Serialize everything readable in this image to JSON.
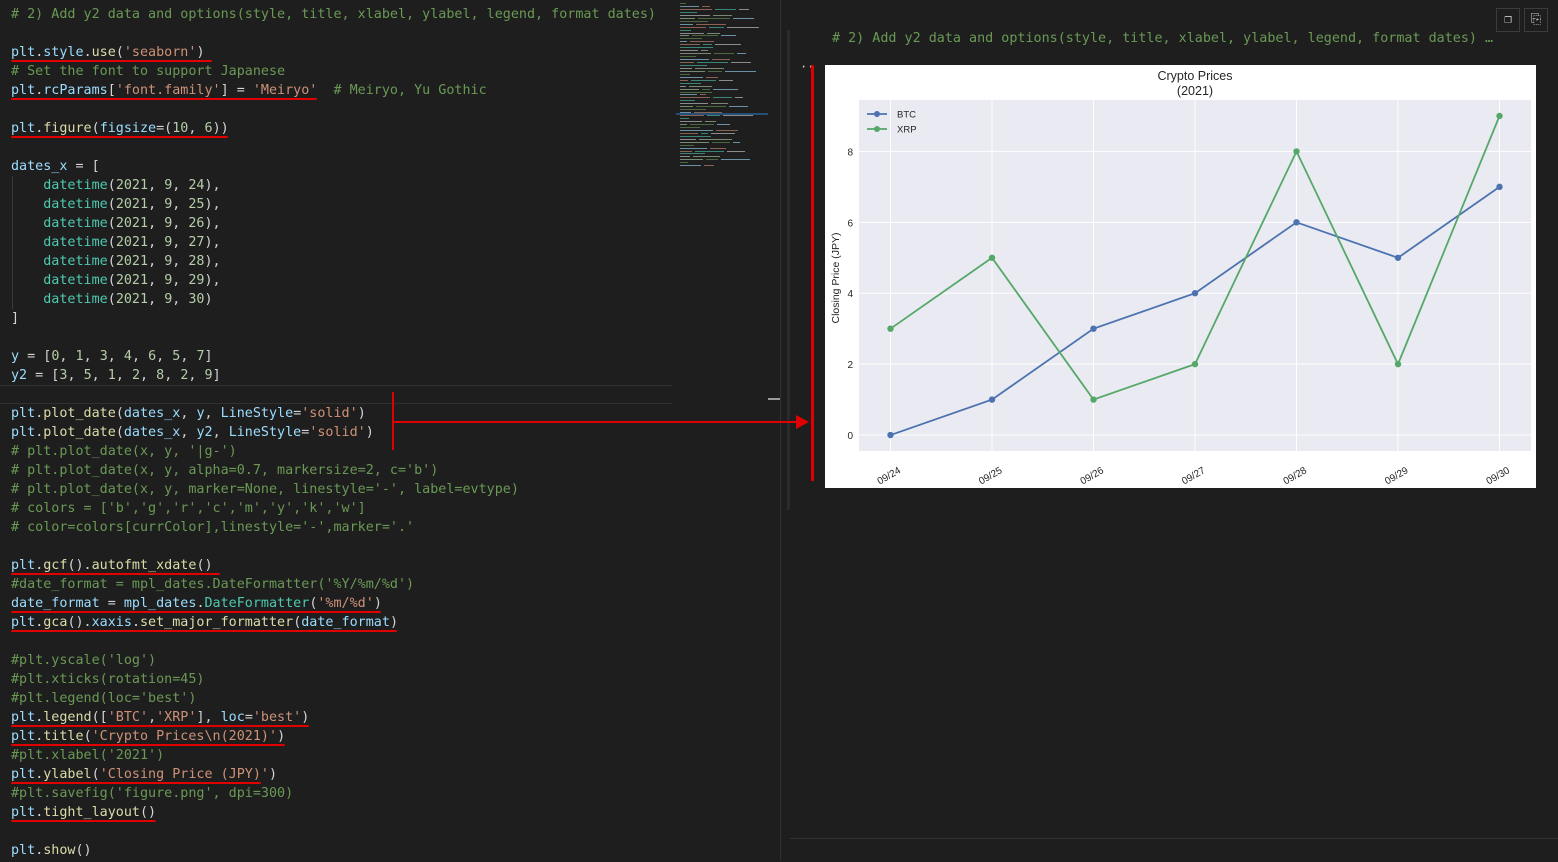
{
  "code": [
    {
      "y": 5,
      "tokens": [
        {
          "t": "# 2) Add y2 data and options(style, title, xlabel, ylabel, legend, format dates)",
          "c": "com"
        }
      ]
    },
    {
      "y": 43,
      "tokens": [
        {
          "t": "plt",
          "c": "var"
        },
        {
          "t": ".",
          "c": "plain"
        },
        {
          "t": "style",
          "c": "var"
        },
        {
          "t": ".",
          "c": "plain"
        },
        {
          "t": "use",
          "c": "fn"
        },
        {
          "t": "(",
          "c": "plain"
        },
        {
          "t": "'seaborn'",
          "c": "str"
        },
        {
          "t": ")",
          "c": "plain"
        }
      ]
    },
    {
      "y": 62,
      "tokens": [
        {
          "t": "# Set the font to support Japanese",
          "c": "com"
        }
      ]
    },
    {
      "y": 81,
      "tokens": [
        {
          "t": "plt",
          "c": "var"
        },
        {
          "t": ".",
          "c": "plain"
        },
        {
          "t": "rcParams",
          "c": "var"
        },
        {
          "t": "[",
          "c": "plain"
        },
        {
          "t": "'font.family'",
          "c": "str"
        },
        {
          "t": "] = ",
          "c": "plain"
        },
        {
          "t": "'Meiryo'",
          "c": "str"
        },
        {
          "t": "  ",
          "c": "plain"
        },
        {
          "t": "# Meiryo, Yu Gothic",
          "c": "com"
        }
      ]
    },
    {
      "y": 119,
      "tokens": [
        {
          "t": "plt",
          "c": "var"
        },
        {
          "t": ".",
          "c": "plain"
        },
        {
          "t": "figure",
          "c": "fn"
        },
        {
          "t": "(",
          "c": "plain"
        },
        {
          "t": "figsize",
          "c": "var"
        },
        {
          "t": "=(",
          "c": "plain"
        },
        {
          "t": "10",
          "c": "num"
        },
        {
          "t": ", ",
          "c": "plain"
        },
        {
          "t": "6",
          "c": "num"
        },
        {
          "t": "))",
          "c": "plain"
        }
      ]
    },
    {
      "y": 157,
      "tokens": [
        {
          "t": "dates_x",
          "c": "var"
        },
        {
          "t": " = [",
          "c": "plain"
        }
      ]
    },
    {
      "y": 176,
      "tokens": [
        {
          "t": "    ",
          "c": "plain"
        },
        {
          "t": "datetime",
          "c": "cls"
        },
        {
          "t": "(",
          "c": "plain"
        },
        {
          "t": "2021",
          "c": "num"
        },
        {
          "t": ", ",
          "c": "plain"
        },
        {
          "t": "9",
          "c": "num"
        },
        {
          "t": ", ",
          "c": "plain"
        },
        {
          "t": "24",
          "c": "num"
        },
        {
          "t": "),",
          "c": "plain"
        }
      ]
    },
    {
      "y": 195,
      "tokens": [
        {
          "t": "    ",
          "c": "plain"
        },
        {
          "t": "datetime",
          "c": "cls"
        },
        {
          "t": "(",
          "c": "plain"
        },
        {
          "t": "2021",
          "c": "num"
        },
        {
          "t": ", ",
          "c": "plain"
        },
        {
          "t": "9",
          "c": "num"
        },
        {
          "t": ", ",
          "c": "plain"
        },
        {
          "t": "25",
          "c": "num"
        },
        {
          "t": "),",
          "c": "plain"
        }
      ]
    },
    {
      "y": 214,
      "tokens": [
        {
          "t": "    ",
          "c": "plain"
        },
        {
          "t": "datetime",
          "c": "cls"
        },
        {
          "t": "(",
          "c": "plain"
        },
        {
          "t": "2021",
          "c": "num"
        },
        {
          "t": ", ",
          "c": "plain"
        },
        {
          "t": "9",
          "c": "num"
        },
        {
          "t": ", ",
          "c": "plain"
        },
        {
          "t": "26",
          "c": "num"
        },
        {
          "t": "),",
          "c": "plain"
        }
      ]
    },
    {
      "y": 233,
      "tokens": [
        {
          "t": "    ",
          "c": "plain"
        },
        {
          "t": "datetime",
          "c": "cls"
        },
        {
          "t": "(",
          "c": "plain"
        },
        {
          "t": "2021",
          "c": "num"
        },
        {
          "t": ", ",
          "c": "plain"
        },
        {
          "t": "9",
          "c": "num"
        },
        {
          "t": ", ",
          "c": "plain"
        },
        {
          "t": "27",
          "c": "num"
        },
        {
          "t": "),",
          "c": "plain"
        }
      ]
    },
    {
      "y": 252,
      "tokens": [
        {
          "t": "    ",
          "c": "plain"
        },
        {
          "t": "datetime",
          "c": "cls"
        },
        {
          "t": "(",
          "c": "plain"
        },
        {
          "t": "2021",
          "c": "num"
        },
        {
          "t": ", ",
          "c": "plain"
        },
        {
          "t": "9",
          "c": "num"
        },
        {
          "t": ", ",
          "c": "plain"
        },
        {
          "t": "28",
          "c": "num"
        },
        {
          "t": "),",
          "c": "plain"
        }
      ]
    },
    {
      "y": 271,
      "tokens": [
        {
          "t": "    ",
          "c": "plain"
        },
        {
          "t": "datetime",
          "c": "cls"
        },
        {
          "t": "(",
          "c": "plain"
        },
        {
          "t": "2021",
          "c": "num"
        },
        {
          "t": ", ",
          "c": "plain"
        },
        {
          "t": "9",
          "c": "num"
        },
        {
          "t": ", ",
          "c": "plain"
        },
        {
          "t": "29",
          "c": "num"
        },
        {
          "t": "),",
          "c": "plain"
        }
      ]
    },
    {
      "y": 290,
      "tokens": [
        {
          "t": "    ",
          "c": "plain"
        },
        {
          "t": "datetime",
          "c": "cls"
        },
        {
          "t": "(",
          "c": "plain"
        },
        {
          "t": "2021",
          "c": "num"
        },
        {
          "t": ", ",
          "c": "plain"
        },
        {
          "t": "9",
          "c": "num"
        },
        {
          "t": ", ",
          "c": "plain"
        },
        {
          "t": "30",
          "c": "num"
        },
        {
          "t": ")",
          "c": "plain"
        }
      ]
    },
    {
      "y": 309,
      "tokens": [
        {
          "t": "]",
          "c": "plain"
        }
      ]
    },
    {
      "y": 347,
      "tokens": [
        {
          "t": "y",
          "c": "var"
        },
        {
          "t": " = [",
          "c": "plain"
        },
        {
          "t": "0",
          "c": "num"
        },
        {
          "t": ", ",
          "c": "plain"
        },
        {
          "t": "1",
          "c": "num"
        },
        {
          "t": ", ",
          "c": "plain"
        },
        {
          "t": "3",
          "c": "num"
        },
        {
          "t": ", ",
          "c": "plain"
        },
        {
          "t": "4",
          "c": "num"
        },
        {
          "t": ", ",
          "c": "plain"
        },
        {
          "t": "6",
          "c": "num"
        },
        {
          "t": ", ",
          "c": "plain"
        },
        {
          "t": "5",
          "c": "num"
        },
        {
          "t": ", ",
          "c": "plain"
        },
        {
          "t": "7",
          "c": "num"
        },
        {
          "t": "]",
          "c": "plain"
        }
      ]
    },
    {
      "y": 366,
      "tokens": [
        {
          "t": "y2",
          "c": "var"
        },
        {
          "t": " = [",
          "c": "plain"
        },
        {
          "t": "3",
          "c": "num"
        },
        {
          "t": ", ",
          "c": "plain"
        },
        {
          "t": "5",
          "c": "num"
        },
        {
          "t": ", ",
          "c": "plain"
        },
        {
          "t": "1",
          "c": "num"
        },
        {
          "t": ", ",
          "c": "plain"
        },
        {
          "t": "2",
          "c": "num"
        },
        {
          "t": ", ",
          "c": "plain"
        },
        {
          "t": "8",
          "c": "num"
        },
        {
          "t": ", ",
          "c": "plain"
        },
        {
          "t": "2",
          "c": "num"
        },
        {
          "t": ", ",
          "c": "plain"
        },
        {
          "t": "9",
          "c": "num"
        },
        {
          "t": "]",
          "c": "plain"
        }
      ]
    },
    {
      "y": 404,
      "tokens": [
        {
          "t": "plt",
          "c": "var"
        },
        {
          "t": ".",
          "c": "plain"
        },
        {
          "t": "plot_date",
          "c": "fn"
        },
        {
          "t": "(",
          "c": "plain"
        },
        {
          "t": "dates_x",
          "c": "var"
        },
        {
          "t": ", ",
          "c": "plain"
        },
        {
          "t": "y",
          "c": "var"
        },
        {
          "t": ", ",
          "c": "plain"
        },
        {
          "t": "LineStyle",
          "c": "var"
        },
        {
          "t": "=",
          "c": "plain"
        },
        {
          "t": "'solid'",
          "c": "str"
        },
        {
          "t": ")",
          "c": "plain"
        }
      ]
    },
    {
      "y": 423,
      "tokens": [
        {
          "t": "plt",
          "c": "var"
        },
        {
          "t": ".",
          "c": "plain"
        },
        {
          "t": "plot_date",
          "c": "fn"
        },
        {
          "t": "(",
          "c": "plain"
        },
        {
          "t": "dates_x",
          "c": "var"
        },
        {
          "t": ", ",
          "c": "plain"
        },
        {
          "t": "y2",
          "c": "var"
        },
        {
          "t": ", ",
          "c": "plain"
        },
        {
          "t": "LineStyle",
          "c": "var"
        },
        {
          "t": "=",
          "c": "plain"
        },
        {
          "t": "'solid'",
          "c": "str"
        },
        {
          "t": ")",
          "c": "plain"
        }
      ]
    },
    {
      "y": 442,
      "tokens": [
        {
          "t": "# plt.plot_date(x, y, '|g-')",
          "c": "com"
        }
      ]
    },
    {
      "y": 461,
      "tokens": [
        {
          "t": "# plt.plot_date(x, y, alpha=0.7, markersize=2, c='b')",
          "c": "com"
        }
      ]
    },
    {
      "y": 480,
      "tokens": [
        {
          "t": "# plt.plot_date(x, y, marker=None, linestyle='-', label=evtype)",
          "c": "com"
        }
      ]
    },
    {
      "y": 499,
      "tokens": [
        {
          "t": "# colors = ['b','g','r','c','m','y','k','w']",
          "c": "com"
        }
      ]
    },
    {
      "y": 518,
      "tokens": [
        {
          "t": "# color=colors[currColor],linestyle='-',marker='.'",
          "c": "com"
        }
      ]
    },
    {
      "y": 556,
      "tokens": [
        {
          "t": "plt",
          "c": "var"
        },
        {
          "t": ".",
          "c": "plain"
        },
        {
          "t": "gcf",
          "c": "fn"
        },
        {
          "t": "().",
          "c": "plain"
        },
        {
          "t": "autofmt_xdate",
          "c": "fn"
        },
        {
          "t": "()",
          "c": "plain"
        }
      ]
    },
    {
      "y": 575,
      "tokens": [
        {
          "t": "#date_format = mpl_dates.DateFormatter('%Y/%m/%d')",
          "c": "com"
        }
      ]
    },
    {
      "y": 594,
      "tokens": [
        {
          "t": "date_format",
          "c": "var"
        },
        {
          "t": " = ",
          "c": "plain"
        },
        {
          "t": "mpl_dates",
          "c": "var"
        },
        {
          "t": ".",
          "c": "plain"
        },
        {
          "t": "DateFormatter",
          "c": "cls"
        },
        {
          "t": "(",
          "c": "plain"
        },
        {
          "t": "'%m/%d'",
          "c": "str"
        },
        {
          "t": ")",
          "c": "plain"
        }
      ]
    },
    {
      "y": 613,
      "tokens": [
        {
          "t": "plt",
          "c": "var"
        },
        {
          "t": ".",
          "c": "plain"
        },
        {
          "t": "gca",
          "c": "fn"
        },
        {
          "t": "().",
          "c": "plain"
        },
        {
          "t": "xaxis",
          "c": "var"
        },
        {
          "t": ".",
          "c": "plain"
        },
        {
          "t": "set_major_formatter",
          "c": "fn"
        },
        {
          "t": "(",
          "c": "plain"
        },
        {
          "t": "date_format",
          "c": "var"
        },
        {
          "t": ")",
          "c": "plain"
        }
      ]
    },
    {
      "y": 651,
      "tokens": [
        {
          "t": "#plt.yscale('log')",
          "c": "com"
        }
      ]
    },
    {
      "y": 670,
      "tokens": [
        {
          "t": "#plt.xticks(rotation=45)",
          "c": "com"
        }
      ]
    },
    {
      "y": 689,
      "tokens": [
        {
          "t": "#plt.legend(loc='best')",
          "c": "com"
        }
      ]
    },
    {
      "y": 708,
      "tokens": [
        {
          "t": "plt",
          "c": "var"
        },
        {
          "t": ".",
          "c": "plain"
        },
        {
          "t": "legend",
          "c": "fn"
        },
        {
          "t": "([",
          "c": "plain"
        },
        {
          "t": "'BTC'",
          "c": "str"
        },
        {
          "t": ",",
          "c": "plain"
        },
        {
          "t": "'XRP'",
          "c": "str"
        },
        {
          "t": "], ",
          "c": "plain"
        },
        {
          "t": "loc",
          "c": "var"
        },
        {
          "t": "=",
          "c": "plain"
        },
        {
          "t": "'best'",
          "c": "str"
        },
        {
          "t": ")",
          "c": "plain"
        }
      ]
    },
    {
      "y": 727,
      "tokens": [
        {
          "t": "plt",
          "c": "var"
        },
        {
          "t": ".",
          "c": "plain"
        },
        {
          "t": "title",
          "c": "fn"
        },
        {
          "t": "(",
          "c": "plain"
        },
        {
          "t": "'Crypto Prices\\n(2021)'",
          "c": "str"
        },
        {
          "t": ")",
          "c": "plain"
        }
      ]
    },
    {
      "y": 746,
      "tokens": [
        {
          "t": "#plt.xlabel('2021')",
          "c": "com"
        }
      ]
    },
    {
      "y": 765,
      "tokens": [
        {
          "t": "plt",
          "c": "var"
        },
        {
          "t": ".",
          "c": "plain"
        },
        {
          "t": "ylabel",
          "c": "fn"
        },
        {
          "t": "(",
          "c": "plain"
        },
        {
          "t": "'Closing Price (JPY)'",
          "c": "str"
        },
        {
          "t": ")",
          "c": "plain"
        }
      ]
    },
    {
      "y": 784,
      "tokens": [
        {
          "t": "#plt.savefig('figure.png', dpi=300)",
          "c": "com"
        }
      ]
    },
    {
      "y": 803,
      "tokens": [
        {
          "t": "plt",
          "c": "var"
        },
        {
          "t": ".",
          "c": "plain"
        },
        {
          "t": "tight_layout",
          "c": "fn"
        },
        {
          "t": "()",
          "c": "plain"
        }
      ]
    },
    {
      "y": 841,
      "tokens": [
        {
          "t": "plt",
          "c": "var"
        },
        {
          "t": ".",
          "c": "plain"
        },
        {
          "t": "show",
          "c": "fn"
        },
        {
          "t": "()",
          "c": "plain"
        }
      ]
    }
  ],
  "output": {
    "header": "# 2) Add y2 data and options(style, title, xlabel, ylabel, legend, format dates) …",
    "more_dots": "··",
    "copy_icon": "copy-icon",
    "clipboard_icon": "clipboard-icon"
  },
  "chart_data": {
    "type": "line",
    "title": "Crypto Prices\n(2021)",
    "xlabel": "",
    "ylabel": "Closing Price (JPY)",
    "categories": [
      "09/24",
      "09/25",
      "09/26",
      "09/27",
      "09/28",
      "09/29",
      "09/30"
    ],
    "series": [
      {
        "name": "BTC",
        "color": "#4c72b0",
        "values": [
          0,
          1,
          3,
          4,
          6,
          5,
          7
        ]
      },
      {
        "name": "XRP",
        "color": "#55a868",
        "values": [
          3,
          5,
          1,
          2,
          8,
          2,
          9
        ]
      }
    ],
    "yticks": [
      0,
      2,
      4,
      6,
      8
    ],
    "ylim": [
      -0.45,
      9.45
    ],
    "grid": true,
    "legend": "upper-left",
    "background": "#eaeaf2"
  },
  "colors": {
    "annotation_red": "#e00000"
  }
}
